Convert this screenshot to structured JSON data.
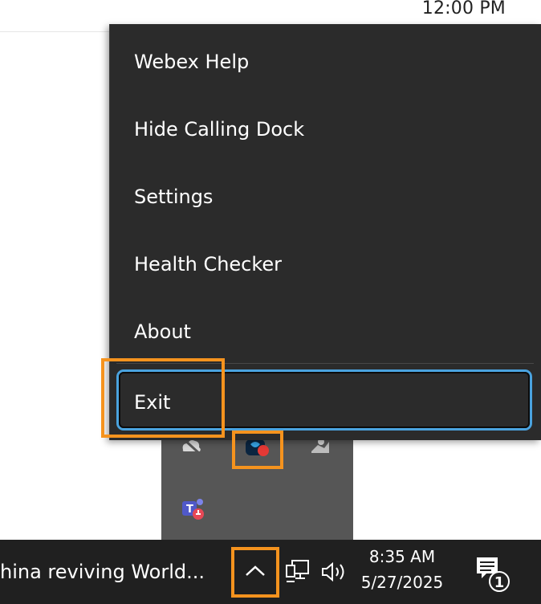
{
  "background": {
    "top_clock": "12:00 PM"
  },
  "context_menu": {
    "items": [
      {
        "label": "Webex Help"
      },
      {
        "label": "Hide Calling Dock"
      },
      {
        "label": "Settings"
      },
      {
        "label": "Health Checker"
      },
      {
        "label": "About"
      }
    ],
    "exit_label": "Exit"
  },
  "tray_flyout": {
    "icons": [
      "cloud-icon",
      "webex-icon",
      "camera-icon",
      "teams-icon"
    ]
  },
  "taskbar": {
    "news_text": "hina reviving World...",
    "time": "8:35 AM",
    "date": "5/27/2025",
    "notification_count": "1"
  },
  "colors": {
    "highlight": "#f5931e",
    "menu_bg": "#2b2b2b",
    "focus_ring": "#4aa3df",
    "taskbar_bg": "#202020",
    "tray_bg": "#565656"
  }
}
